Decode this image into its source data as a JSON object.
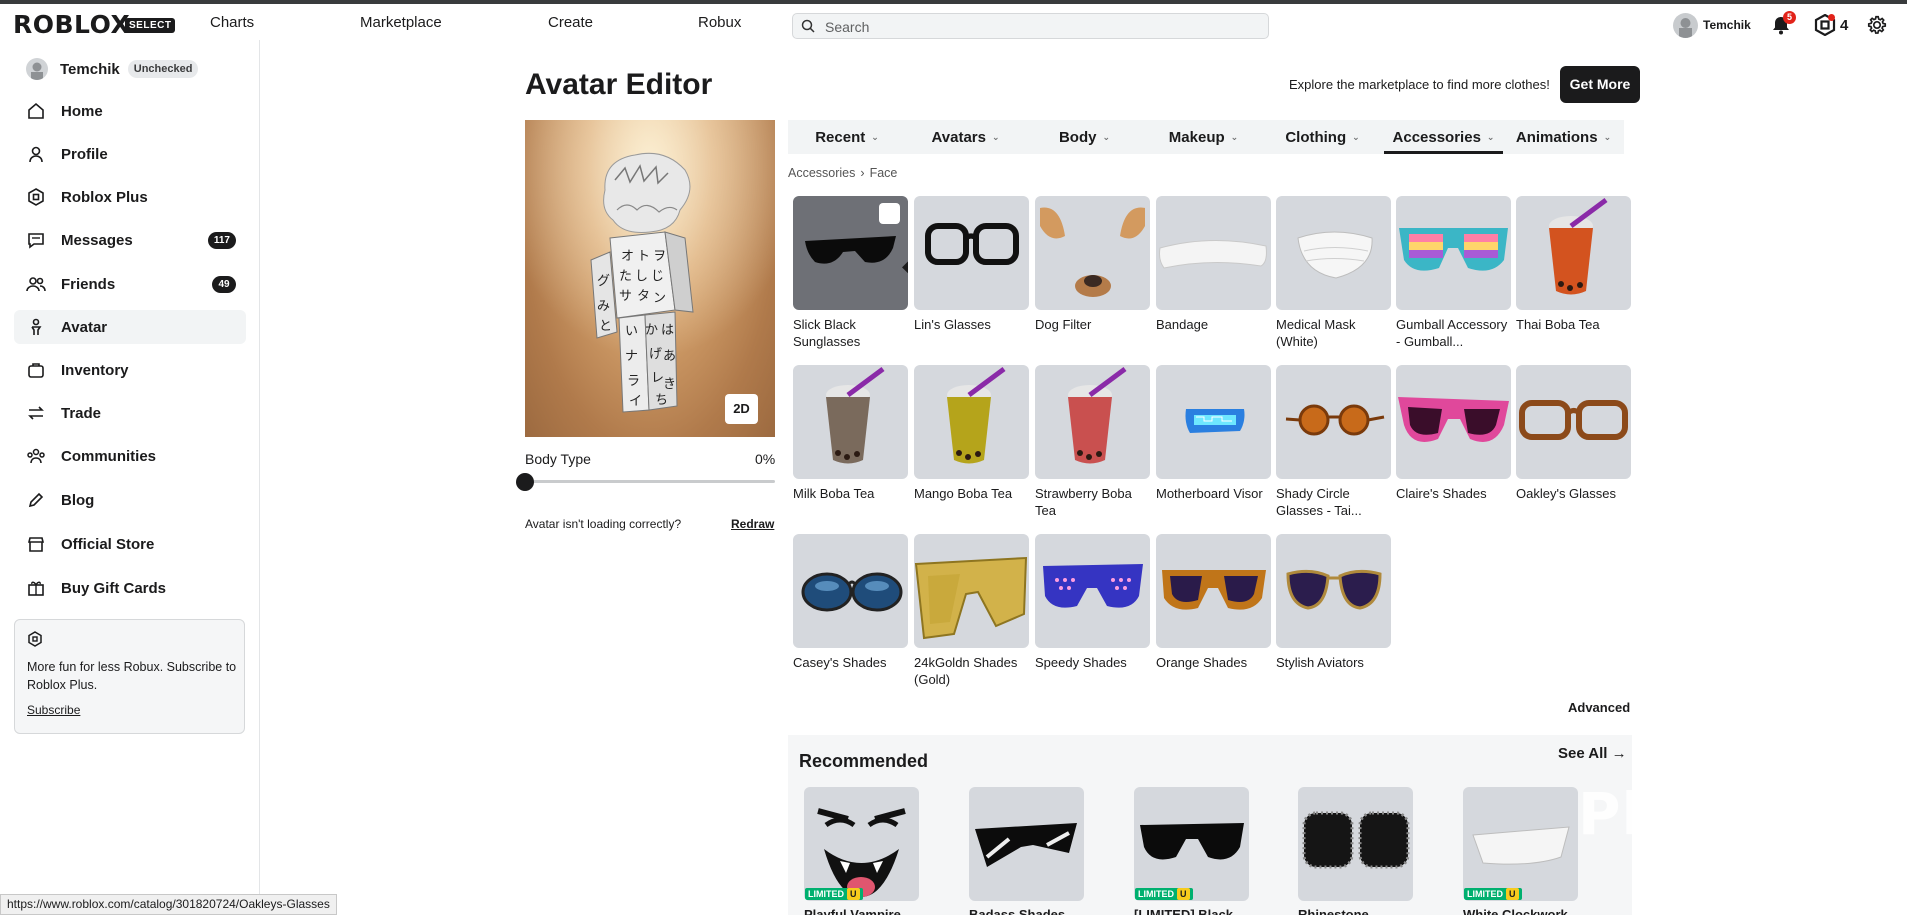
{
  "topbar": {
    "logo": "ROBLOX",
    "logo_badge": "SELECT",
    "nav": [
      "Charts",
      "Marketplace",
      "Create",
      "Robux"
    ],
    "search_placeholder": "Search",
    "username": "Temchik",
    "notifications": "5",
    "robux": "4"
  },
  "sidebar": {
    "username": "Temchik",
    "user_badge": "Unchecked",
    "items": [
      {
        "label": "Home",
        "icon": "home-icon"
      },
      {
        "label": "Profile",
        "icon": "profile-icon"
      },
      {
        "label": "Roblox Plus",
        "icon": "roblox-plus-icon"
      },
      {
        "label": "Messages",
        "icon": "messages-icon",
        "count": "117"
      },
      {
        "label": "Friends",
        "icon": "friends-icon",
        "count": "49"
      },
      {
        "label": "Avatar",
        "icon": "avatar-icon",
        "active": true
      },
      {
        "label": "Inventory",
        "icon": "inventory-icon"
      },
      {
        "label": "Trade",
        "icon": "trade-icon"
      },
      {
        "label": "Communities",
        "icon": "communities-icon"
      },
      {
        "label": "Blog",
        "icon": "blog-icon"
      },
      {
        "label": "Official Store",
        "icon": "store-icon"
      },
      {
        "label": "Buy Gift Cards",
        "icon": "gift-card-icon"
      }
    ],
    "promo_text": "More fun for less Robux. Subscribe to Roblox Plus.",
    "promo_link": "Subscribe"
  },
  "main": {
    "title": "Avatar Editor",
    "explore_text": "Explore the marketplace to find more clothes!",
    "get_more": "Get More",
    "view_toggle": "2D",
    "body_type_label": "Body Type",
    "body_type_value": "0%",
    "body_type_level": 0,
    "not_loading": "Avatar isn't loading correctly?",
    "redraw": "Redraw",
    "tabs": [
      "Recent",
      "Avatars",
      "Body",
      "Makeup",
      "Clothing",
      "Accessories",
      "Animations"
    ],
    "active_tab": "Accessories",
    "breadcrumb": [
      "Accessories",
      "Face"
    ],
    "items": [
      {
        "name": "Slick Black Sunglasses",
        "selected": true
      },
      {
        "name": "Lin's Glasses"
      },
      {
        "name": "Dog Filter"
      },
      {
        "name": "Bandage"
      },
      {
        "name": "Medical Mask (White)"
      },
      {
        "name": "Gumball Accessory - Gumball..."
      },
      {
        "name": "Thai Boba Tea"
      },
      {
        "name": "Milk Boba Tea"
      },
      {
        "name": "Mango Boba Tea"
      },
      {
        "name": "Strawberry Boba Tea"
      },
      {
        "name": "Motherboard Visor"
      },
      {
        "name": "Shady Circle Glasses - Tai..."
      },
      {
        "name": "Claire's Shades"
      },
      {
        "name": "Oakley's Glasses"
      },
      {
        "name": "Casey's Shades"
      },
      {
        "name": "24kGoldn Shades (Gold)"
      },
      {
        "name": "Speedy Shades"
      },
      {
        "name": "Orange Shades"
      },
      {
        "name": "Stylish Aviators"
      }
    ],
    "advanced": "Advanced"
  },
  "recommended": {
    "title": "Recommended",
    "see_all": "See All",
    "limited_label": "LIMITED",
    "limited_u": "U",
    "items": [
      {
        "name": "Playful Vampire",
        "limited": true
      },
      {
        "name": "Badass Shades",
        "limited": false
      },
      {
        "name": "[LIMITED] Black",
        "limited": true
      },
      {
        "name": "Rhinestone",
        "limited": false
      },
      {
        "name": "White Clockwork",
        "limited": true
      }
    ]
  },
  "watermark": "Playerok",
  "status_url": "https://www.roblox.com/catalog/301820724/Oakleys-Glasses"
}
